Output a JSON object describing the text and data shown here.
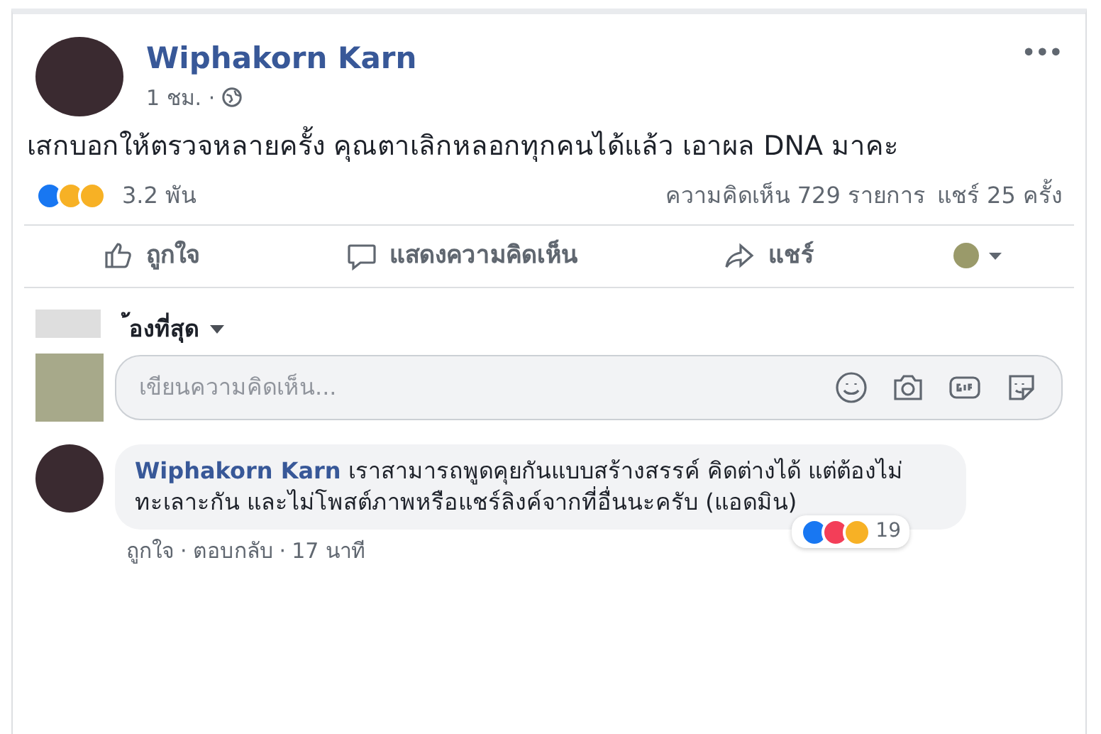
{
  "post": {
    "author": "Wiphakorn Karn",
    "time": "1 ชม. ·",
    "more": "•••",
    "text": "เสกบอกให้ตรวจหลายครั้ง คุณตาเลิกหลอกทุกคนได้แล้ว เอาผล DNA มาคะ",
    "reactions": [
      {
        "kind": "like"
      },
      {
        "kind": "haha"
      },
      {
        "kind": "wow"
      }
    ],
    "reaction_count": "3.2 พัน",
    "comments_count": "ความคิดเห็น 729 รายการ",
    "shares_count": "แชร์ 25 ครั้ง"
  },
  "actions": [
    {
      "kind": "like",
      "label": "ถูกใจ"
    },
    {
      "kind": "comment",
      "label": "แสดงความคิดเห็น"
    },
    {
      "kind": "share",
      "label": "แชร์"
    }
  ],
  "sort": {
    "label": "้องที่สุด"
  },
  "composer": {
    "placeholder": "เขียนความคิดเห็น..."
  },
  "comments": [
    {
      "author": "Wiphakorn Karn",
      "text": "เราสามารถพูดคุยกันแบบสร้างสรรค์ คิดต่างได้ แต่ต้องไม่ทะเลาะกัน และไม่โพสต์ภาพหรือแชร์ลิงค์จากที่อื่นนะครับ (แอดมิน)",
      "like": "ถูกใจ",
      "sep": "·",
      "reply": "ตอบกลับ",
      "time": "17 นาที",
      "reactions": [
        {
          "kind": "like"
        },
        {
          "kind": "love"
        },
        {
          "kind": "haha"
        }
      ],
      "reaction_count": "19"
    }
  ]
}
